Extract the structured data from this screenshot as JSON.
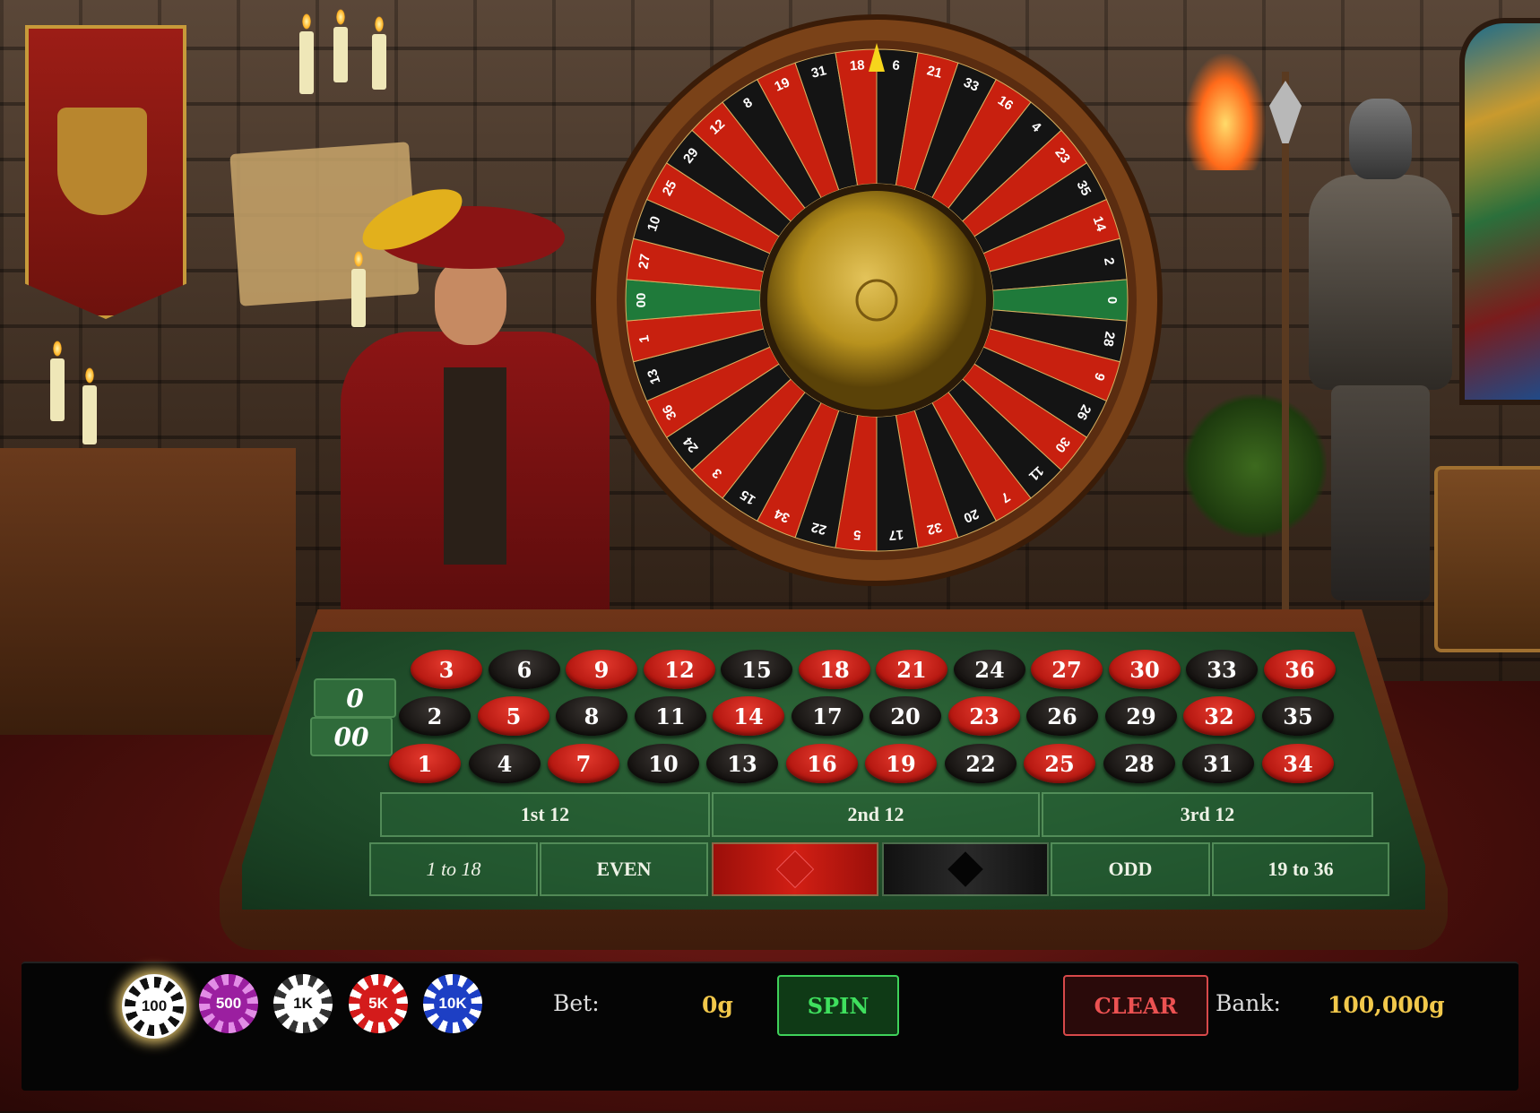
{
  "wheel": {
    "sequence": [
      "6",
      "21",
      "33",
      "16",
      "4",
      "23",
      "35",
      "14",
      "2",
      "0",
      "28",
      "9",
      "26",
      "30",
      "11",
      "7",
      "20",
      "32",
      "17",
      "5",
      "22",
      "34",
      "15",
      "3",
      "24",
      "36",
      "13",
      "1",
      "00",
      "27",
      "10",
      "25",
      "29",
      "12",
      "8",
      "19",
      "31",
      "18"
    ],
    "colors": {
      "6": "black",
      "21": "red",
      "33": "black",
      "16": "red",
      "4": "black",
      "23": "red",
      "35": "black",
      "14": "red",
      "2": "black",
      "0": "green",
      "28": "black",
      "9": "red",
      "26": "black",
      "30": "red",
      "11": "black",
      "7": "red",
      "20": "black",
      "32": "red",
      "17": "black",
      "5": "red",
      "22": "black",
      "34": "red",
      "15": "black",
      "3": "red",
      "24": "black",
      "36": "red",
      "13": "black",
      "1": "red",
      "00": "green",
      "27": "red",
      "10": "black",
      "25": "red",
      "29": "black",
      "12": "red",
      "8": "black",
      "19": "red",
      "31": "black",
      "18": "red"
    },
    "palette": {
      "red": "#c8200f",
      "black": "#141414",
      "green": "#1f7a3a",
      "rim": "#7a4218",
      "hub": "#b8921e",
      "pointer": "#f6d51c"
    }
  },
  "table": {
    "zeros": [
      "0",
      "00"
    ],
    "rows": [
      [
        {
          "n": "3",
          "c": "red"
        },
        {
          "n": "6",
          "c": "black"
        },
        {
          "n": "9",
          "c": "red"
        },
        {
          "n": "12",
          "c": "red"
        },
        {
          "n": "15",
          "c": "black"
        },
        {
          "n": "18",
          "c": "red"
        },
        {
          "n": "21",
          "c": "red"
        },
        {
          "n": "24",
          "c": "black"
        },
        {
          "n": "27",
          "c": "red"
        },
        {
          "n": "30",
          "c": "red"
        },
        {
          "n": "33",
          "c": "black"
        },
        {
          "n": "36",
          "c": "red"
        }
      ],
      [
        {
          "n": "2",
          "c": "black"
        },
        {
          "n": "5",
          "c": "red"
        },
        {
          "n": "8",
          "c": "black"
        },
        {
          "n": "11",
          "c": "black"
        },
        {
          "n": "14",
          "c": "red"
        },
        {
          "n": "17",
          "c": "black"
        },
        {
          "n": "20",
          "c": "black"
        },
        {
          "n": "23",
          "c": "red"
        },
        {
          "n": "26",
          "c": "black"
        },
        {
          "n": "29",
          "c": "black"
        },
        {
          "n": "32",
          "c": "red"
        },
        {
          "n": "35",
          "c": "black"
        }
      ],
      [
        {
          "n": "1",
          "c": "red"
        },
        {
          "n": "4",
          "c": "black"
        },
        {
          "n": "7",
          "c": "red"
        },
        {
          "n": "10",
          "c": "black"
        },
        {
          "n": "13",
          "c": "black"
        },
        {
          "n": "16",
          "c": "red"
        },
        {
          "n": "19",
          "c": "red"
        },
        {
          "n": "22",
          "c": "black"
        },
        {
          "n": "25",
          "c": "red"
        },
        {
          "n": "28",
          "c": "black"
        },
        {
          "n": "31",
          "c": "black"
        },
        {
          "n": "34",
          "c": "red"
        }
      ]
    ],
    "dozens": [
      "1st 12",
      "2nd 12",
      "3rd 12"
    ],
    "outside": {
      "low": "1 to 18",
      "even": "EVEN",
      "odd": "ODD",
      "high": "19 to 36"
    }
  },
  "controls": {
    "chips": [
      {
        "label": "100",
        "selected": true
      },
      {
        "label": "500",
        "selected": false
      },
      {
        "label": "1K",
        "selected": false
      },
      {
        "label": "5K",
        "selected": false
      },
      {
        "label": "10K",
        "selected": false
      }
    ],
    "bet_label": "Bet:",
    "bet_value": "0g",
    "spin_label": "SPIN",
    "clear_label": "CLEAR",
    "bank_label": "Bank:",
    "bank_value": "100,000g"
  }
}
